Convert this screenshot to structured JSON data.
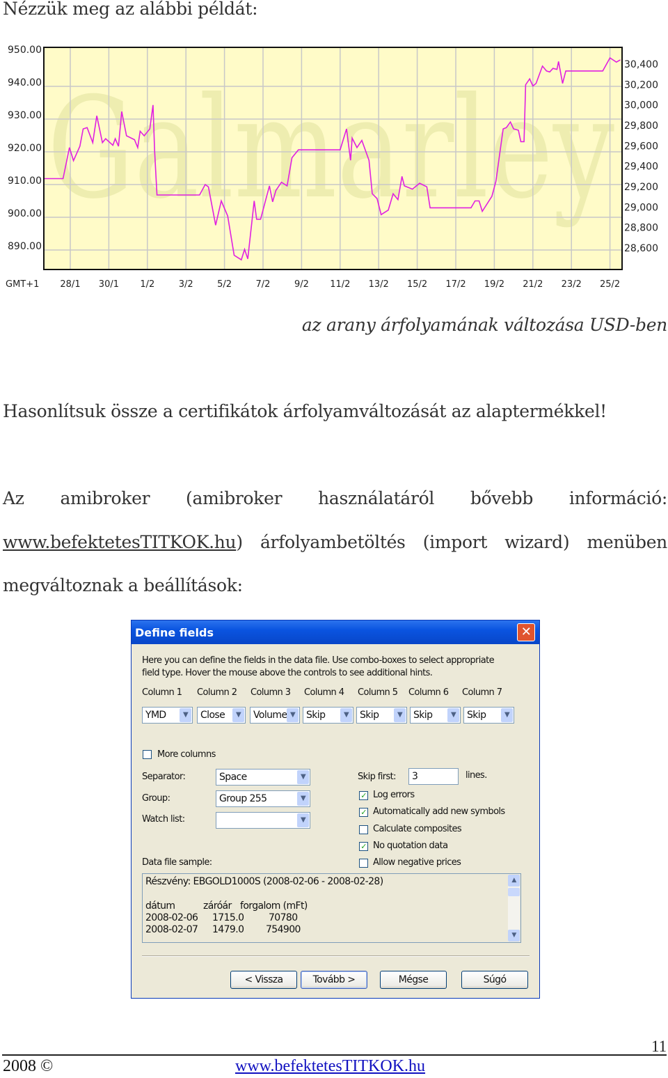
{
  "intro": "Nézzük meg az alábbi példát:",
  "chart_data": {
    "type": "line",
    "watermark": "Galmarley",
    "x_tick_labels": [
      "GMT+1",
      "28/1",
      "30/1",
      "1/2",
      "3/2",
      "5/2",
      "7/2",
      "9/2",
      "11/2",
      "13/2",
      "15/2",
      "17/2",
      "19/2",
      "21/2",
      "23/2",
      "25/2"
    ],
    "y_left_ticks": [
      "950.00",
      "940.00",
      "930.00",
      "920.00",
      "910.00",
      "900.00",
      "890.00"
    ],
    "y_right_ticks": [
      "30,400",
      "30,200",
      "30,000",
      "29,800",
      "29,600",
      "29,400",
      "29,200",
      "29,000",
      "28,800",
      "28,600"
    ],
    "ylim_left": [
      885,
      952
    ],
    "grid": true,
    "colors": {
      "line": "#E020E0",
      "background": "#FFFBC8",
      "grid": "#C8C8C8",
      "watermark": "#EEEDB0"
    },
    "series": [
      {
        "points": [
          [
            "26/1 15:00",
            911.8
          ],
          [
            "27/1 15:00",
            911.8
          ],
          [
            "27/1 23:00",
            921.3
          ],
          [
            "28/1 04:00",
            917.3
          ],
          [
            "28/1 12:00",
            921.7
          ],
          [
            "28/1 16:00",
            927.0
          ],
          [
            "28/1 21:00",
            927.4
          ],
          [
            "29/1 04:00",
            922.8
          ],
          [
            "29/1 09:00",
            931.0
          ],
          [
            "29/1 16:00",
            922.8
          ],
          [
            "29/1 20:00",
            924.0
          ],
          [
            "30/1 05:00",
            922.0
          ],
          [
            "30/1 08:00",
            924.0
          ],
          [
            "30/1 12:00",
            921.7
          ],
          [
            "30/1 16:00",
            932.3
          ],
          [
            "30/1 22:00",
            924.9
          ],
          [
            "31/1 08:00",
            923.7
          ],
          [
            "31/1 12:00",
            921.3
          ],
          [
            "31/1 15:00",
            926.3
          ],
          [
            "31/1 20:00",
            924.9
          ],
          [
            "1/2 03:00",
            927.0
          ],
          [
            "1/2 07:00",
            934.3
          ],
          [
            "1/2 09:00",
            920.3
          ],
          [
            "1/2 12:00",
            906.8
          ],
          [
            "3/2 17:00",
            906.8
          ],
          [
            "4/2 00:00",
            910.0
          ],
          [
            "4/2 04:00",
            909.3
          ],
          [
            "4/2 13:00",
            897.6
          ],
          [
            "4/2 20:00",
            905.0
          ],
          [
            "5/2 04:00",
            900.4
          ],
          [
            "5/2 12:00",
            888.4
          ],
          [
            "5/2 21:00",
            887.0
          ],
          [
            "6/2 01:00",
            890.2
          ],
          [
            "6/2 05:00",
            887.3
          ],
          [
            "6/2 13:00",
            905.0
          ],
          [
            "6/2 16:00",
            899.4
          ],
          [
            "6/2 21:00",
            899.4
          ],
          [
            "7/2 08:00",
            909.6
          ],
          [
            "7/2 12:00",
            904.7
          ],
          [
            "7/2 16:00",
            908.2
          ],
          [
            "7/2 23:00",
            910.7
          ],
          [
            "8/2 06:00",
            909.6
          ],
          [
            "8/2 12:00",
            918.2
          ],
          [
            "8/2 20:00",
            920.6
          ],
          [
            "11/2 00:00",
            920.6
          ],
          [
            "11/2 08:00",
            927.0
          ],
          [
            "11/2 13:00",
            917.4
          ],
          [
            "11/2 15:00",
            924.2
          ],
          [
            "11/2 21:00",
            921.3
          ],
          [
            "12/2 03:00",
            923.5
          ],
          [
            "12/2 12:00",
            917.4
          ],
          [
            "12/2 16:00",
            907.2
          ],
          [
            "12/2 22:00",
            905.7
          ],
          [
            "13/2 03:00",
            900.8
          ],
          [
            "13/2 12:00",
            902.2
          ],
          [
            "13/2 18:00",
            907.2
          ],
          [
            "14/2 00:00",
            905.4
          ],
          [
            "14/2 05:00",
            912.5
          ],
          [
            "14/2 08:00",
            909.6
          ],
          [
            "14/2 18:00",
            908.6
          ],
          [
            "15/2 03:00",
            910.4
          ],
          [
            "15/2 12:00",
            909.3
          ],
          [
            "15/2 16:00",
            902.9
          ],
          [
            "17/2 19:00",
            902.9
          ],
          [
            "18/2 00:00",
            905.0
          ],
          [
            "18/2 05:00",
            905.0
          ],
          [
            "18/2 09:00",
            901.8
          ],
          [
            "18/2 21:00",
            906.4
          ],
          [
            "19/2 02:00",
            911.0
          ],
          [
            "19/2 11:00",
            927.0
          ],
          [
            "19/2 15:00",
            927.4
          ],
          [
            "19/2 20:00",
            929.1
          ],
          [
            "20/2 00:00",
            927.0
          ],
          [
            "20/2 06:00",
            926.6
          ],
          [
            "20/2 09:00",
            923.1
          ],
          [
            "20/2 13:00",
            923.1
          ],
          [
            "20/2 15:00",
            940.5
          ],
          [
            "20/2 20:00",
            942.3
          ],
          [
            "21/2 00:00",
            940.1
          ],
          [
            "21/2 04:00",
            940.9
          ],
          [
            "21/2 12:00",
            946.2
          ],
          [
            "21/2 17:00",
            944.7
          ],
          [
            "21/2 21:00",
            944.4
          ],
          [
            "22/2 01:00",
            945.5
          ],
          [
            "22/2 06:00",
            945.2
          ],
          [
            "22/2 08:00",
            947.6
          ],
          [
            "22/2 13:00",
            940.9
          ],
          [
            "22/2 17:00",
            944.7
          ],
          [
            "24/2 15:00",
            944.7
          ],
          [
            "25/2 00:00",
            948.7
          ],
          [
            "25/2 08:00",
            947.4
          ],
          [
            "25/2 13:00",
            948.1
          ]
        ]
      }
    ]
  },
  "caption": "az arany árfolyamának változása USD-ben",
  "para1": "Hasonlítsuk össze a certifikátok árfolyamváltozását az alaptermékkel!",
  "para2": {
    "line1": [
      "Az",
      "amibroker",
      "(amibroker",
      "használatáról",
      "bővebb",
      "információ:"
    ],
    "link": "www.befektetesTITKOK.hu",
    "line2_rest": [
      ")",
      "árfolyambetöltés",
      "(import",
      "wizard)",
      "menüben"
    ],
    "line3": "megváltoznak a beállítások:"
  },
  "dialog": {
    "title": "Define fields",
    "description_1": "Here you can define the fields in the data file. Use combo-boxes to select appropriate",
    "description_2": "field type. Hover the mouse above the controls to see additional hints.",
    "columns": [
      {
        "label": "Column 1",
        "value": "YMD"
      },
      {
        "label": "Column 2",
        "value": "Close"
      },
      {
        "label": "Column 3",
        "value": "Volume"
      },
      {
        "label": "Column 4",
        "value": "Skip"
      },
      {
        "label": "Column 5",
        "value": "Skip"
      },
      {
        "label": "Column 6",
        "value": "Skip"
      },
      {
        "label": "Column 7",
        "value": "Skip"
      }
    ],
    "more_columns": {
      "label": "More columns",
      "checked": false
    },
    "separator": {
      "label": "Separator:",
      "value": "Space"
    },
    "group": {
      "label": "Group:",
      "value": "Group 255"
    },
    "watch_list": {
      "label": "Watch list:",
      "value": ""
    },
    "skip_first": {
      "label": "Skip first:",
      "value": "3",
      "suffix": "lines."
    },
    "options": [
      {
        "label": "Log errors",
        "checked": true
      },
      {
        "label": "Automatically add new symbols",
        "checked": true
      },
      {
        "label": "Calculate composites",
        "checked": false
      },
      {
        "label": "No quotation data",
        "checked": true
      },
      {
        "label": "Allow negative prices",
        "checked": false
      }
    ],
    "sample_label": "Data file sample:",
    "sample": {
      "header": "Részvény: EBGOLD1000S (2008-02-06 - 2008-02-28)",
      "columns": [
        "dátum",
        "záróár",
        "forgalom (mFt)"
      ],
      "rows": [
        [
          "2008-02-06",
          "1715.0",
          "70780"
        ],
        [
          "2008-02-07",
          "1479.0",
          "754900"
        ]
      ]
    },
    "buttons": {
      "back": "< Vissza",
      "next": "Tovább >",
      "cancel": "Mégse",
      "help": "Súgó"
    }
  },
  "footer": {
    "page_number": "11",
    "copyright": "2008 ©",
    "link": "www.befektetesTITKOK.hu"
  }
}
